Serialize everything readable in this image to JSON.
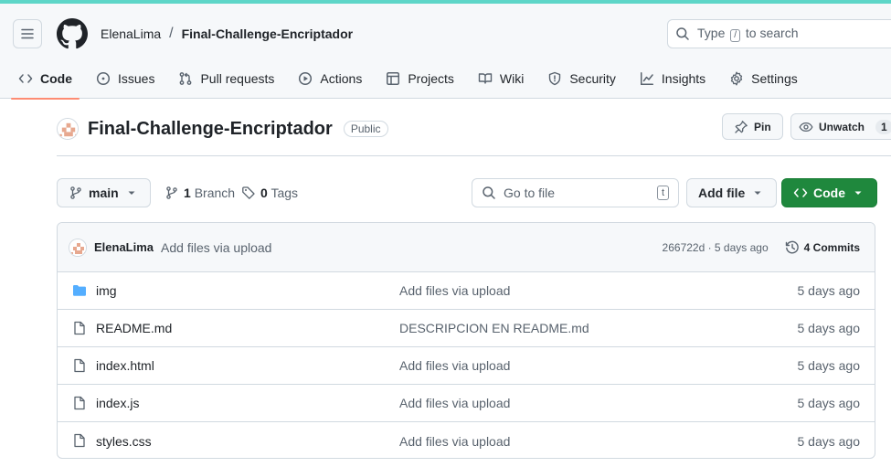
{
  "colors": {
    "accent_strip": "#5ed6c8",
    "tab_underline": "#fd8c73",
    "code_button": "#1f883d",
    "folder": "#54aeff"
  },
  "header": {
    "owner": "ElenaLima",
    "separator": "/",
    "repo": "Final-Challenge-Encriptador",
    "search": {
      "prefix": "Type",
      "key": "/",
      "suffix": "to search"
    }
  },
  "tabs": [
    {
      "label": "Code",
      "icon": "code-icon",
      "selected": true
    },
    {
      "label": "Issues",
      "icon": "issue-icon"
    },
    {
      "label": "Pull requests",
      "icon": "pull-request-icon"
    },
    {
      "label": "Actions",
      "icon": "play-icon"
    },
    {
      "label": "Projects",
      "icon": "table-icon"
    },
    {
      "label": "Wiki",
      "icon": "book-icon"
    },
    {
      "label": "Security",
      "icon": "shield-icon"
    },
    {
      "label": "Insights",
      "icon": "graph-icon"
    },
    {
      "label": "Settings",
      "icon": "gear-icon"
    }
  ],
  "repo": {
    "name": "Final-Challenge-Encriptador",
    "visibility": "Public",
    "pin_label": "Pin",
    "watch_label": "Unwatch",
    "watch_count": "1"
  },
  "toolbar": {
    "branch": "main",
    "branch_count": "1",
    "branch_label": "Branch",
    "tag_count": "0",
    "tag_label": "Tags",
    "goto_placeholder": "Go to file",
    "goto_key": "t",
    "add_file": "Add file",
    "code": "Code"
  },
  "commit": {
    "author": "ElenaLima",
    "message": "Add files via upload",
    "sha_time": "266722d · 5 days ago",
    "commits_label": "4 Commits"
  },
  "files": [
    {
      "type": "folder",
      "name": "img",
      "message": "Add files via upload",
      "age": "5 days ago"
    },
    {
      "type": "file",
      "name": "README.md",
      "message": "DESCRIPCION EN README.md",
      "age": "5 days ago"
    },
    {
      "type": "file",
      "name": "index.html",
      "message": "Add files via upload",
      "age": "5 days ago"
    },
    {
      "type": "file",
      "name": "index.js",
      "message": "Add files via upload",
      "age": "5 days ago"
    },
    {
      "type": "file",
      "name": "styles.css",
      "message": "Add files via upload",
      "age": "5 days ago"
    }
  ]
}
